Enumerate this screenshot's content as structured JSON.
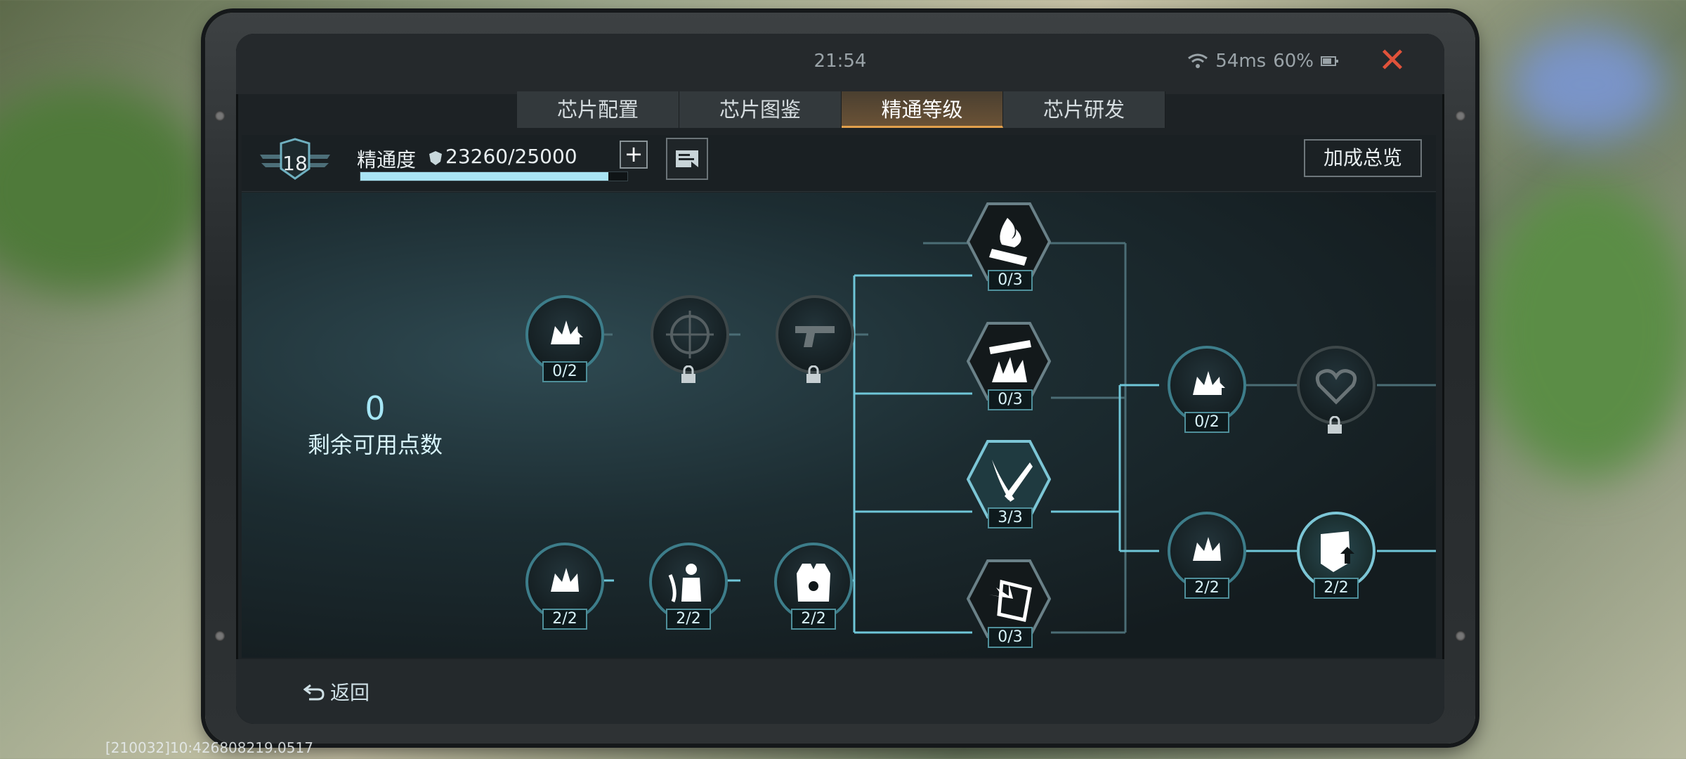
{
  "clock": "21:54",
  "status": {
    "ping": "54ms",
    "battery": "60%"
  },
  "tabs": [
    {
      "label": "芯片配置"
    },
    {
      "label": "芯片图鉴"
    },
    {
      "label": "精通等级"
    },
    {
      "label": "芯片研发"
    }
  ],
  "active_tab": "精通等级",
  "mastery": {
    "level": "18",
    "label": "精通度",
    "value": "23260/25000",
    "progress": 0.93
  },
  "summary_button": "加成总览",
  "points": {
    "value": "0",
    "label": "剩余可用点数"
  },
  "nodes": {
    "top_row_1": "0/2",
    "fire_mag": "0/3",
    "grass_blast": "0/3",
    "dual_blade": "3/3",
    "shield_burst": "0/3",
    "right_up_1": "0/2",
    "bottom_row_1": "2/2",
    "bottom_row_2": "2/2",
    "bottom_row_3": "2/2",
    "right_low_1": "2/2",
    "right_low_2": "2/2"
  },
  "back_label": "返回",
  "debug_text": "[210032]10:426808219.0517",
  "colors": {
    "accent": "#a9e4f4",
    "tab_active": "#e2a04c",
    "close": "#e0523a"
  }
}
